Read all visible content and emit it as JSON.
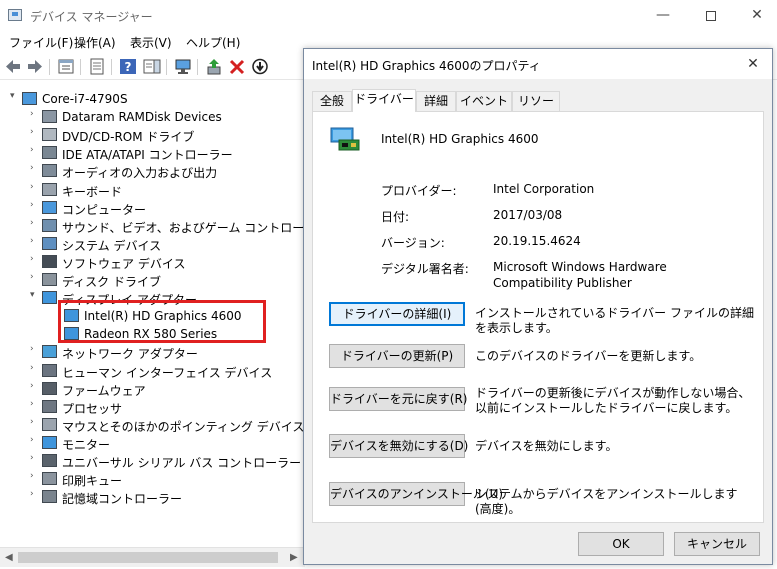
{
  "window": {
    "title": "デバイス マネージャー"
  },
  "menu": [
    "ファイル(F)",
    "操作(A)",
    "表示(V)",
    "ヘルプ(H)"
  ],
  "tree": {
    "root": "Core-i7-4790S",
    "items": [
      {
        "label": "Dataram RAMDisk Devices",
        "icon": "disk-icon",
        "expanded": false
      },
      {
        "label": "DVD/CD-ROM ドライブ",
        "icon": "dvd-icon",
        "expanded": false
      },
      {
        "label": "IDE ATA/ATAPI コントローラー",
        "icon": "ide-icon",
        "expanded": false
      },
      {
        "label": "オーディオの入力および出力",
        "icon": "speaker-icon",
        "expanded": false
      },
      {
        "label": "キーボード",
        "icon": "keyboard-icon",
        "expanded": false
      },
      {
        "label": "コンピューター",
        "icon": "computer-icon",
        "expanded": false
      },
      {
        "label": "サウンド、ビデオ、およびゲーム コントローラー",
        "icon": "sound-icon",
        "expanded": false
      },
      {
        "label": "システム デバイス",
        "icon": "system-icon",
        "expanded": false
      },
      {
        "label": "ソフトウェア デバイス",
        "icon": "software-icon",
        "expanded": false
      },
      {
        "label": "ディスク ドライブ",
        "icon": "disk-drive-icon",
        "expanded": false
      },
      {
        "label": "ディスプレイ アダプター",
        "icon": "display-icon",
        "expanded": true,
        "children": [
          "Intel(R) HD Graphics 4600",
          "Radeon RX 580 Series"
        ]
      },
      {
        "label": "ネットワーク アダプター",
        "icon": "network-icon",
        "expanded": false
      },
      {
        "label": "ヒューマン インターフェイス デバイス",
        "icon": "hid-icon",
        "expanded": false
      },
      {
        "label": "ファームウェア",
        "icon": "firmware-icon",
        "expanded": false
      },
      {
        "label": "プロセッサ",
        "icon": "processor-icon",
        "expanded": false
      },
      {
        "label": "マウスとそのほかのポインティング デバイス",
        "icon": "mouse-icon",
        "expanded": false
      },
      {
        "label": "モニター",
        "icon": "monitor-icon",
        "expanded": false
      },
      {
        "label": "ユニバーサル シリアル バス コントローラー",
        "icon": "usb-icon",
        "expanded": false
      },
      {
        "label": "印刷キュー",
        "icon": "printer-icon",
        "expanded": false
      },
      {
        "label": "記憶域コントローラー",
        "icon": "storage-icon",
        "expanded": false
      }
    ]
  },
  "dialog": {
    "title": "Intel(R) HD Graphics 4600のプロパティ",
    "tabs": [
      "全般",
      "ドライバー",
      "詳細",
      "イベント",
      "リソース"
    ],
    "active_tab": 1,
    "device_name": "Intel(R) HD Graphics 4600",
    "props": [
      {
        "label": "プロバイダー:",
        "value": "Intel Corporation"
      },
      {
        "label": "日付:",
        "value": "2017/03/08"
      },
      {
        "label": "バージョン:",
        "value": "20.19.15.4624"
      },
      {
        "label": "デジタル署名者:",
        "value": "Microsoft Windows Hardware Compatibility Publisher"
      }
    ],
    "actions": [
      {
        "label": "ドライバーの詳細(I)",
        "desc": "インストールされているドライバー ファイルの詳細を表示します。"
      },
      {
        "label": "ドライバーの更新(P)",
        "desc": "このデバイスのドライバーを更新します。"
      },
      {
        "label": "ドライバーを元に戻す(R)",
        "desc": "ドライバーの更新後にデバイスが動作しない場合、以前にインストールしたドライバーに戻します。"
      },
      {
        "label": "デバイスを無効にする(D)",
        "desc": "デバイスを無効にします。"
      },
      {
        "label": "デバイスのアンインストール(U)",
        "desc": "システムからデバイスをアンインストールします (高度)。"
      }
    ],
    "ok": "OK",
    "cancel": "キャンセル"
  },
  "colors": {
    "highlight": "#e02020",
    "accent": "#0078d7"
  }
}
